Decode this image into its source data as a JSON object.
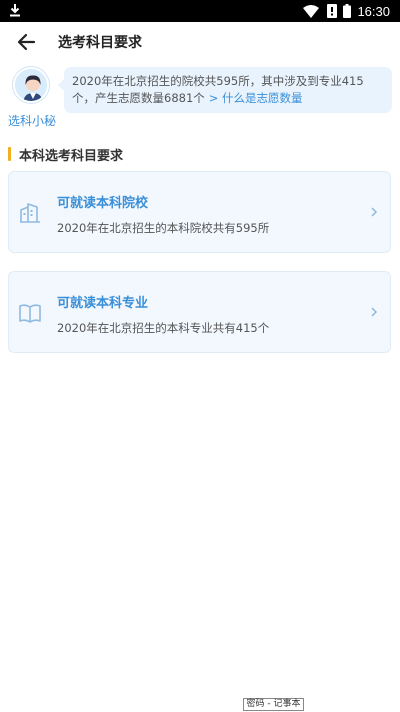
{
  "status_bar": {
    "time": "16:30"
  },
  "header": {
    "title": "选考科目要求"
  },
  "assistant": {
    "name": "选科小秘",
    "message": "2020年在北京招生的院校共595所，其中涉及到专业415个，产生志愿数量6881个",
    "link": "> 什么是志愿数量"
  },
  "section": {
    "title": "本科选考科目要求"
  },
  "cards": [
    {
      "title": "可就读本科院校",
      "subtitle": "2020年在北京招生的本科院校共有595所"
    },
    {
      "title": "可就读本科专业",
      "subtitle": "2020年在北京招生的本科专业共有415个"
    }
  ],
  "ime": {
    "label": "密码 - 记事本"
  },
  "colors": {
    "accent": "#3a8fd8",
    "section_marker": "#f2b021",
    "card_bg": "#f2f8fe",
    "bubble_bg": "#e8f3fd"
  }
}
